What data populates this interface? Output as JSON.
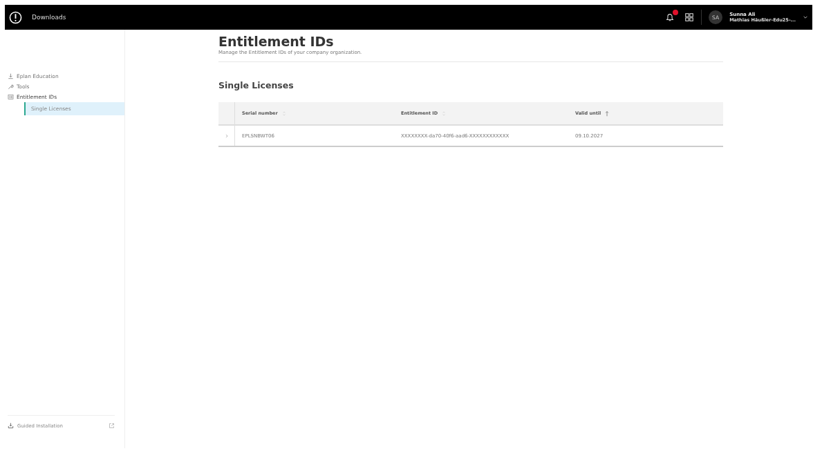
{
  "topbar": {
    "title": "Downloads",
    "notifications": {
      "unread": true
    },
    "user": {
      "initials": "SA",
      "name": "Sunna Ali",
      "org": "Mathias Häußler-Edu25-..."
    }
  },
  "sidebar": {
    "items": [
      {
        "label": "Eplan Education",
        "selected": false
      },
      {
        "label": "Tools",
        "selected": false
      },
      {
        "label": "Entitlement IDs",
        "selected": false,
        "children": [
          {
            "label": "Single Licenses",
            "selected": true
          }
        ]
      }
    ],
    "footer": {
      "label": "Guided Installation"
    }
  },
  "page": {
    "title": "Entitlement IDs",
    "subtitle": "Manage the Entitlement IDs of your company organization."
  },
  "section": {
    "title": "Single Licenses"
  },
  "table": {
    "columns": [
      {
        "label": "Serial number",
        "sorted": false
      },
      {
        "label": "Entitlement ID",
        "sorted": false
      },
      {
        "label": "Valid until",
        "sorted": true
      }
    ],
    "rows": [
      {
        "expanded": false,
        "cells": [
          "EPLSNBWT06",
          "XXXXXXXX-da70-40f6-aad6-XXXXXXXXXXXX",
          "09.10.2027"
        ]
      }
    ]
  }
}
